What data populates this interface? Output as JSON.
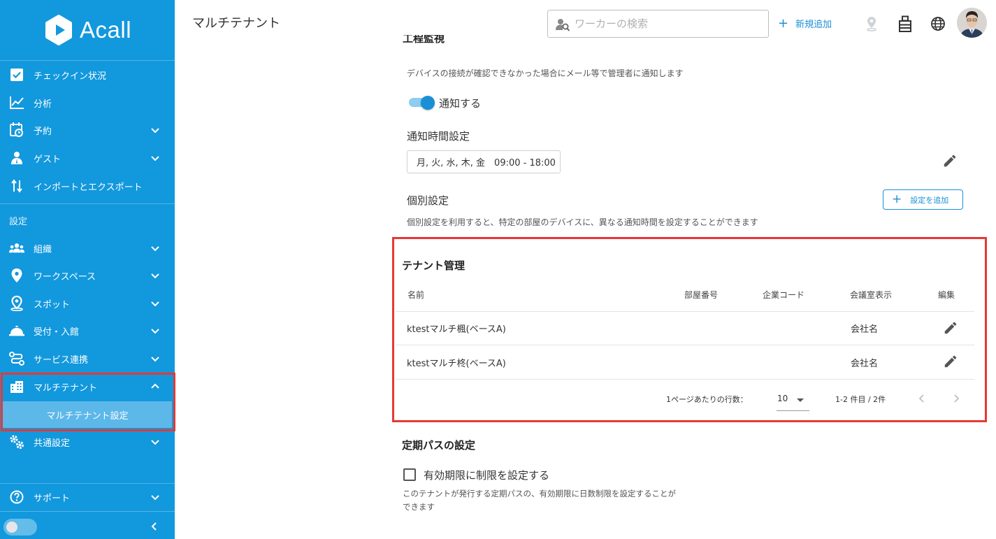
{
  "app": {
    "logo_text": "Acall"
  },
  "sidebar": {
    "items": [
      {
        "label": "チェックイン状況",
        "icon": "checkbox-icon",
        "chevron": false
      },
      {
        "label": "分析",
        "icon": "chart-line-icon",
        "chevron": false
      },
      {
        "label": "予約",
        "icon": "calendar-clock-icon",
        "chevron": true
      },
      {
        "label": "ゲスト",
        "icon": "guest-icon",
        "chevron": true
      },
      {
        "label": "インポートとエクスポート",
        "icon": "import-export-icon",
        "chevron": false
      }
    ],
    "section_label": "設定",
    "settings_items": [
      {
        "label": "組織",
        "icon": "people-icon",
        "chevron": true
      },
      {
        "label": "ワークスペース",
        "icon": "location-pin-icon",
        "chevron": true
      },
      {
        "label": "スポット",
        "icon": "spot-pin-icon",
        "chevron": true
      },
      {
        "label": "受付・入館",
        "icon": "reception-bell-icon",
        "chevron": true
      },
      {
        "label": "サービス連携",
        "icon": "integration-icon",
        "chevron": true
      },
      {
        "label": "マルチテナント",
        "icon": "building-icon",
        "chevron": "up"
      },
      {
        "label": "共通設定",
        "icon": "gears-icon",
        "chevron": true
      }
    ],
    "sub_item": "マルチテナント設定",
    "support_label": "サポート"
  },
  "header": {
    "title": "マルチテナント",
    "search_placeholder": "ワーカーの検索",
    "add_new_label": "新規追加",
    "icons": [
      "map-pin-icon",
      "building-tenant-icon",
      "globe-icon"
    ]
  },
  "notification": {
    "heading_cut": "工程監視",
    "description": "デバイスの接続が確認できなかった場合にメール等で管理者に通知します",
    "toggle_on": true,
    "toggle_label": "通知する",
    "time_title": "通知時間設定",
    "time_value": "月, 火, 水, 木, 金　09:00 - 18:00",
    "individual_title": "個別設定",
    "add_setting_label": "設定を追加",
    "individual_desc": "個別設定を利用すると、特定の部屋のデバイスに、異なる通知時間を設定することができます"
  },
  "tenant": {
    "title": "テナント管理",
    "columns": [
      "名前",
      "部屋番号",
      "企業コード",
      "会議室表示",
      "編集"
    ],
    "rows": [
      {
        "name": "ktestマルチ楓(ベースA)",
        "room": "",
        "code": "",
        "display": "会社名"
      },
      {
        "name": "ktestマルチ柊(ベースA)",
        "room": "",
        "code": "",
        "display": "会社名"
      }
    ],
    "rows_per_page_label": "1ページあたりの行数：",
    "rows_per_page": "10",
    "range": "1-2 件目 / 2件"
  },
  "pass": {
    "title": "定期パスの設定",
    "checkbox_label": "有効期限に制限を設定する",
    "checked": false,
    "description": "このテナントが発行する定期パスの、有効期限に日数制限を設定することができます"
  },
  "colors": {
    "sidebar": "#1298dd",
    "accent": "#1a8fd6",
    "highlight": "#e53935"
  }
}
